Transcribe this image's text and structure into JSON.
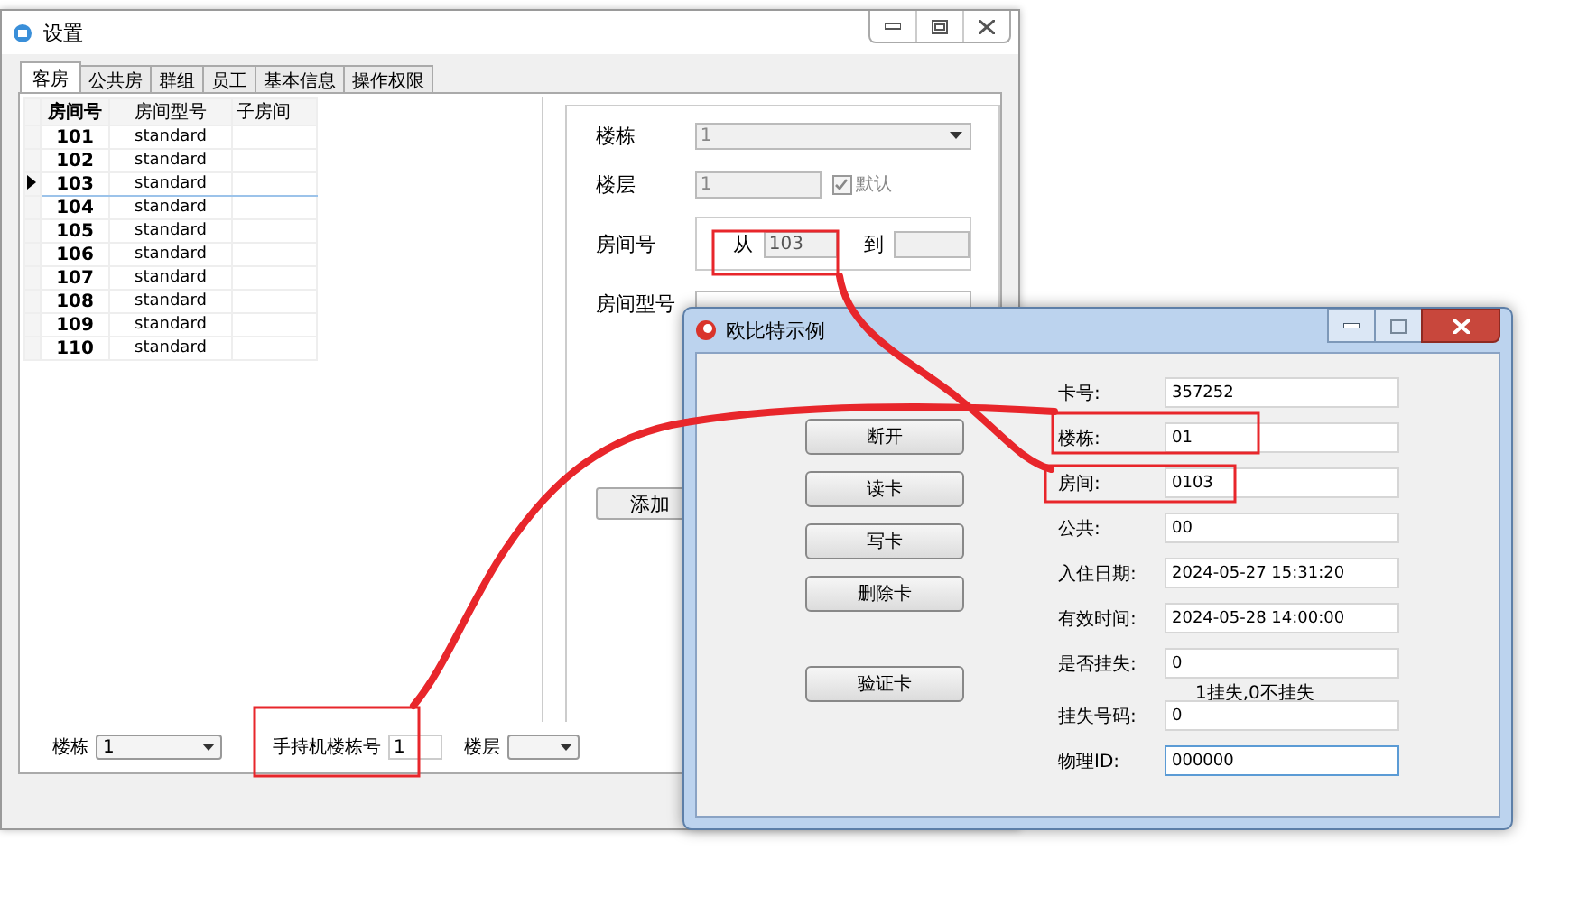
{
  "settings_window": {
    "title": "设置",
    "tabs": [
      {
        "label": "客房",
        "selected": true
      },
      {
        "label": "公共房",
        "selected": false
      },
      {
        "label": "群组",
        "selected": false
      },
      {
        "label": "员工",
        "selected": false
      },
      {
        "label": "基本信息",
        "selected": false
      },
      {
        "label": "操作权限",
        "selected": false
      }
    ],
    "room_table": {
      "columns": [
        "房间号",
        "房间型号",
        "子房间"
      ],
      "rows": [
        {
          "room": "101",
          "type": "standard",
          "selected": false
        },
        {
          "room": "102",
          "type": "standard",
          "selected": false
        },
        {
          "room": "103",
          "type": "standard",
          "selected": true
        },
        {
          "room": "104",
          "type": "standard",
          "selected": false
        },
        {
          "room": "105",
          "type": "standard",
          "selected": false
        },
        {
          "room": "106",
          "type": "standard",
          "selected": false
        },
        {
          "room": "107",
          "type": "standard",
          "selected": false
        },
        {
          "room": "108",
          "type": "standard",
          "selected": false
        },
        {
          "room": "109",
          "type": "standard",
          "selected": false
        },
        {
          "room": "110",
          "type": "standard",
          "selected": false
        }
      ]
    },
    "form": {
      "building": {
        "label": "楼栋",
        "value": "1",
        "disabled": true
      },
      "floor": {
        "label": "楼层",
        "value": "1",
        "disabled": true
      },
      "default_checkbox": {
        "label": "默认",
        "checked": true,
        "disabled": true
      },
      "room_number": {
        "label": "房间号",
        "from_label": "从",
        "from_value": "103",
        "to_label": "到"
      },
      "room_type": {
        "label": "房间型号"
      },
      "add_button": "添加"
    },
    "bottom_bar": {
      "building_label": "楼栋",
      "building_value": "1",
      "handset_label": "手持机楼栋号",
      "handset_value": "1",
      "floor_label": "楼层"
    }
  },
  "card_window": {
    "title": "欧比特示例",
    "buttons": [
      "断开",
      "读卡",
      "写卡",
      "删除卡",
      "验证卡"
    ],
    "fields": [
      {
        "kind": "field",
        "label": "卡号:",
        "value": "357252",
        "focused": false
      },
      {
        "kind": "field",
        "label": "楼栋:",
        "value": "01",
        "focused": false
      },
      {
        "kind": "field",
        "label": "房间:",
        "value": "0103",
        "focused": false
      },
      {
        "kind": "field",
        "label": "公共:",
        "value": "00",
        "focused": false
      },
      {
        "kind": "field",
        "label": "入住日期:",
        "value": "2024-05-27 15:31:20",
        "focused": false
      },
      {
        "kind": "field",
        "label": "有效时间:",
        "value": "2024-05-28 14:00:00",
        "focused": false
      },
      {
        "kind": "field",
        "label": "是否挂失:",
        "value": "0",
        "focused": false
      },
      {
        "kind": "note",
        "label": "1挂失,0不挂失"
      },
      {
        "kind": "field",
        "label": "挂失号码:",
        "value": "0",
        "focused": false
      },
      {
        "kind": "field",
        "label": "物理ID:",
        "value": "000000",
        "focused": true
      }
    ]
  }
}
